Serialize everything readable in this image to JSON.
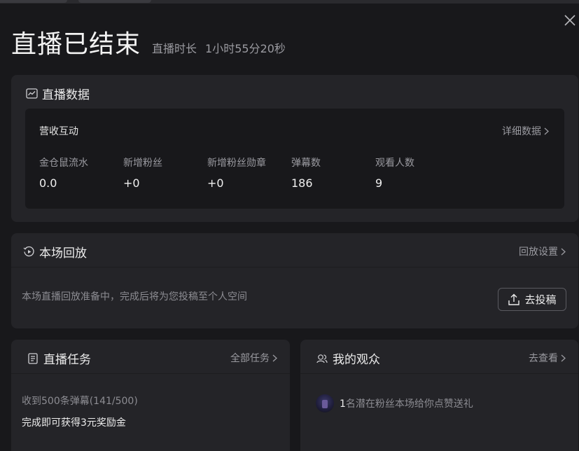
{
  "header": {
    "title": "直播已结束",
    "duration_label": "直播时长",
    "duration_value": "1小时55分20秒"
  },
  "live_data": {
    "title": "直播数据",
    "section_title": "营收互动",
    "detail_link": "详细数据",
    "stats": [
      {
        "label": "金仓鼠流水",
        "value": "0.0"
      },
      {
        "label": "新增粉丝",
        "value": "+0"
      },
      {
        "label": "新增粉丝勋章",
        "value": "+0"
      },
      {
        "label": "弹幕数",
        "value": "186"
      },
      {
        "label": "观看人数",
        "value": "9"
      }
    ]
  },
  "replay": {
    "title": "本场回放",
    "settings_link": "回放设置",
    "description": "本场直播回放准备中，完成后将为您投稿至个人空间",
    "upload_button": "去投稿"
  },
  "tasks": {
    "title": "直播任务",
    "all_link": "全部任务",
    "task_name": "收到500条弹幕(141/500)",
    "task_reward": "完成即可获得3元奖励金"
  },
  "audience": {
    "title": "我的观众",
    "view_link": "去查看",
    "count": "1",
    "message": "名潜在粉丝本场给你点赞送礼"
  },
  "icons": {
    "close": "close-icon",
    "chart": "chart-icon",
    "replay": "replay-icon",
    "upload": "upload-icon",
    "task": "document-icon",
    "audience": "users-icon",
    "chevron": "chevron-right-icon"
  }
}
